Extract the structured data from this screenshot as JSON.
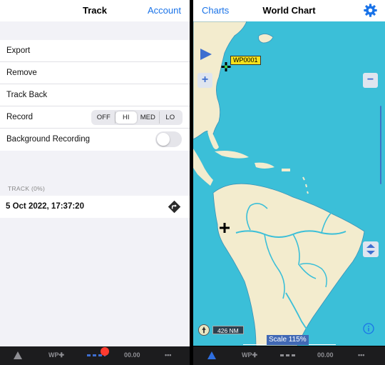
{
  "left": {
    "nav": {
      "title": "Track",
      "account": "Account"
    },
    "rows": {
      "export": "Export",
      "remove": "Remove",
      "track_back": "Track Back",
      "record": "Record",
      "background_recording": "Background Recording"
    },
    "record_options": [
      "OFF",
      "HI",
      "MED",
      "LO"
    ],
    "record_selected": "HI",
    "background_recording_on": false,
    "section_header": "TRACK (0%)",
    "track_entry": "5 Oct 2022, 17:37:20"
  },
  "right": {
    "nav": {
      "back": "Charts",
      "title": "World Chart"
    },
    "waypoint_label": "WP0001",
    "scale_distance": "426 NM",
    "scale_percent": "Scale 115%",
    "zoom_in": "+",
    "zoom_out": "−"
  },
  "tabbar_left": {
    "wp": "WP✚",
    "time": "00.00",
    "more": "•••"
  },
  "tabbar_right": {
    "wp": "WP✚",
    "time": "00.00",
    "more": "•••"
  },
  "colors": {
    "accent": "#1a73e8",
    "water": "#3bbfd8",
    "land": "#f3ecce",
    "record_dot": "#ff3b30"
  }
}
